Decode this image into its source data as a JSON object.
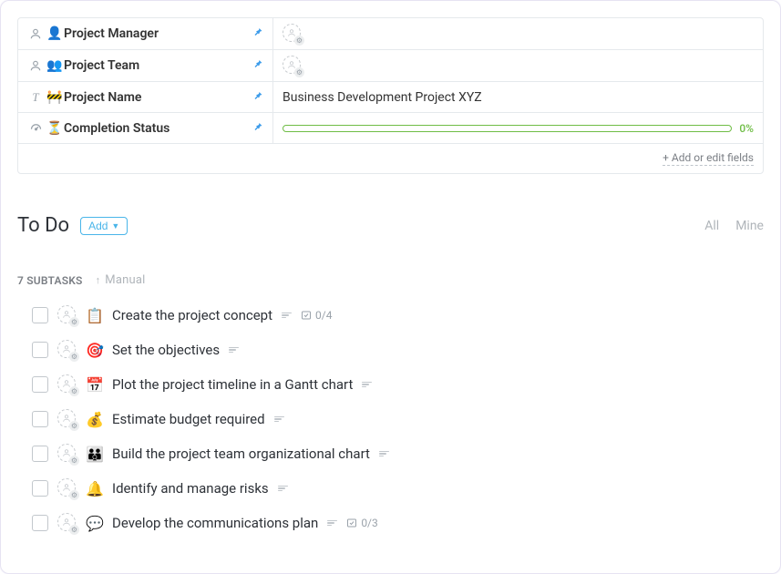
{
  "fields": {
    "project_manager": {
      "type_icon": "person-icon",
      "emoji": "👤",
      "label": "Project Manager",
      "value": ""
    },
    "project_team": {
      "type_icon": "person-icon",
      "emoji": "👥",
      "label": "Project Team",
      "value": ""
    },
    "project_name": {
      "type_icon": "text-icon",
      "type_char": "T",
      "emoji": "🚧",
      "label": "Project Name",
      "value": "Business Development Project XYZ"
    },
    "completion": {
      "type_icon": "gauge-icon",
      "emoji": "⏳",
      "label": "Completion Status",
      "value": "0%"
    }
  },
  "footer": {
    "add_fields": "+ Add or edit fields"
  },
  "section": {
    "title": "To Do",
    "add_label": "Add",
    "filter_all": "All",
    "filter_mine": "Mine",
    "subtasks_count": "7 SUBTASKS",
    "sort_label": "Manual"
  },
  "tasks": [
    {
      "emoji": "📋",
      "title": "Create the project concept",
      "counter": "0/4"
    },
    {
      "emoji": "🎯",
      "title": "Set the objectives",
      "counter": ""
    },
    {
      "emoji": "📅",
      "title": "Plot the project timeline in a Gantt chart",
      "counter": ""
    },
    {
      "emoji": "💰",
      "title": "Estimate budget required",
      "counter": ""
    },
    {
      "emoji": "👪",
      "title": "Build the project team organizational chart",
      "counter": ""
    },
    {
      "emoji": "🔔",
      "title": "Identify and manage risks",
      "counter": ""
    },
    {
      "emoji": "💬",
      "title": "Develop the communications plan",
      "counter": "0/3"
    }
  ]
}
